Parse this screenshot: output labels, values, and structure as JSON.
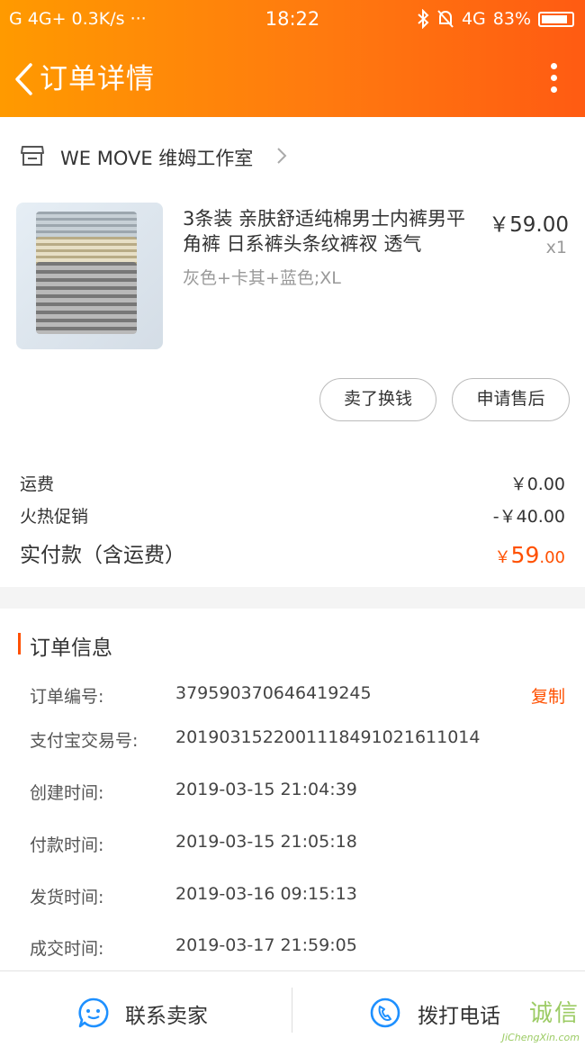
{
  "status_bar": {
    "left_text": "G 4G+ 0.3K/s",
    "more": "···",
    "time": "18:22",
    "network": "4G",
    "battery": "83%"
  },
  "nav": {
    "title": "订单详情"
  },
  "shop": {
    "name": "WE MOVE 维姆工作室"
  },
  "item": {
    "title": "3条装 亲肤舒适纯棉男士内裤男平角裤 日系裤头条纹裤衩 透气",
    "sku": "灰色+卡其+蓝色;XL",
    "price": "￥59.00",
    "qty": "x1"
  },
  "actions": {
    "sell_label": "卖了换钱",
    "aftersale_label": "申请售后"
  },
  "fees": {
    "shipping_label": "运费",
    "shipping_value": "￥0.00",
    "promo_label": "火热促销",
    "promo_value": "-￥40.00",
    "total_label": "实付款（含运费）",
    "total_symbol": "￥",
    "total_int": "59",
    "total_dec": ".00"
  },
  "order_info": {
    "title": "订单信息",
    "copy_label": "复制",
    "rows": [
      {
        "key": "订单编号:",
        "value": "379590370646419245"
      },
      {
        "key": "支付宝交易号:",
        "value": "2019031522001118491021611014"
      },
      {
        "key": "创建时间:",
        "value": "2019-03-15 21:04:39"
      },
      {
        "key": "付款时间:",
        "value": "2019-03-15 21:05:18"
      },
      {
        "key": "发货时间:",
        "value": "2019-03-16 09:15:13"
      },
      {
        "key": "成交时间:",
        "value": "2019-03-17 21:59:05"
      }
    ]
  },
  "bottom": {
    "contact_label": "联系卖家",
    "call_label": "拨打电话"
  },
  "watermark": {
    "main": "诚信",
    "sub": "JiChengXin.com"
  },
  "colors": {
    "accent": "#ff5000",
    "header_start": "#ff9a00",
    "header_end": "#ff5b12",
    "watermark": "#8bc34a"
  }
}
